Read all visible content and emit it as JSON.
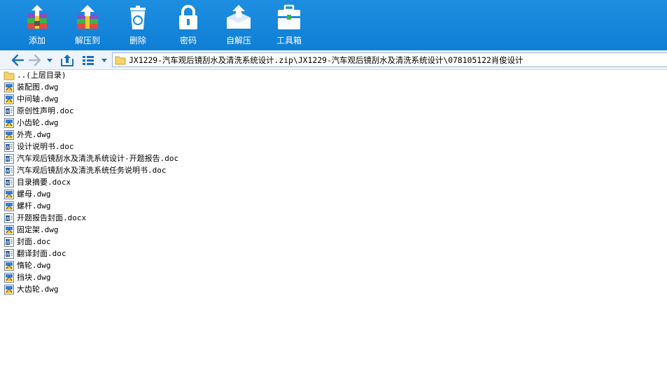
{
  "toolbar": {
    "buttons": [
      {
        "label": "添加",
        "icon": "add-archive-icon"
      },
      {
        "label": "解压到",
        "icon": "extract-to-icon"
      },
      {
        "label": "删除",
        "icon": "delete-icon"
      },
      {
        "label": "密码",
        "icon": "password-lock-icon"
      },
      {
        "label": "自解压",
        "icon": "self-extract-icon"
      },
      {
        "label": "工具箱",
        "icon": "toolbox-icon"
      }
    ]
  },
  "nav": {
    "address": "JX1229-汽车观后镜刮水及清洗系统设计.zip\\JX1229-汽车观后镜刮水及清洗系统设计\\078105122肖俊设计"
  },
  "files": [
    {
      "name": "..(上层目录)",
      "type": "folder"
    },
    {
      "name": "装配图.dwg",
      "type": "dwg"
    },
    {
      "name": "中间轴.dwg",
      "type": "dwg"
    },
    {
      "name": "原创性声明.doc",
      "type": "doc"
    },
    {
      "name": "小齿轮.dwg",
      "type": "dwg"
    },
    {
      "name": "外壳.dwg",
      "type": "dwg"
    },
    {
      "name": "设计说明书.doc",
      "type": "doc"
    },
    {
      "name": "汽车观后镜刮水及清洗系统设计-开题报告.doc",
      "type": "doc"
    },
    {
      "name": "汽车观后镜刮水及清洗系统任务说明书.doc",
      "type": "doc"
    },
    {
      "name": "目录摘要.docx",
      "type": "doc"
    },
    {
      "name": "螺母.dwg",
      "type": "dwg"
    },
    {
      "name": "螺杆.dwg",
      "type": "dwg"
    },
    {
      "name": "开题报告封面.docx",
      "type": "doc"
    },
    {
      "name": "固定架.dwg",
      "type": "dwg"
    },
    {
      "name": "封面.doc",
      "type": "doc"
    },
    {
      "name": "翻译封面.doc",
      "type": "doc"
    },
    {
      "name": "惰轮.dwg",
      "type": "dwg"
    },
    {
      "name": "挡块.dwg",
      "type": "dwg"
    },
    {
      "name": "大齿轮.dwg",
      "type": "dwg"
    }
  ],
  "colors": {
    "toolbar_bg": "#1384d9",
    "nav_bg": "#eef4fb",
    "nav_icon": "#1a6fc0"
  }
}
